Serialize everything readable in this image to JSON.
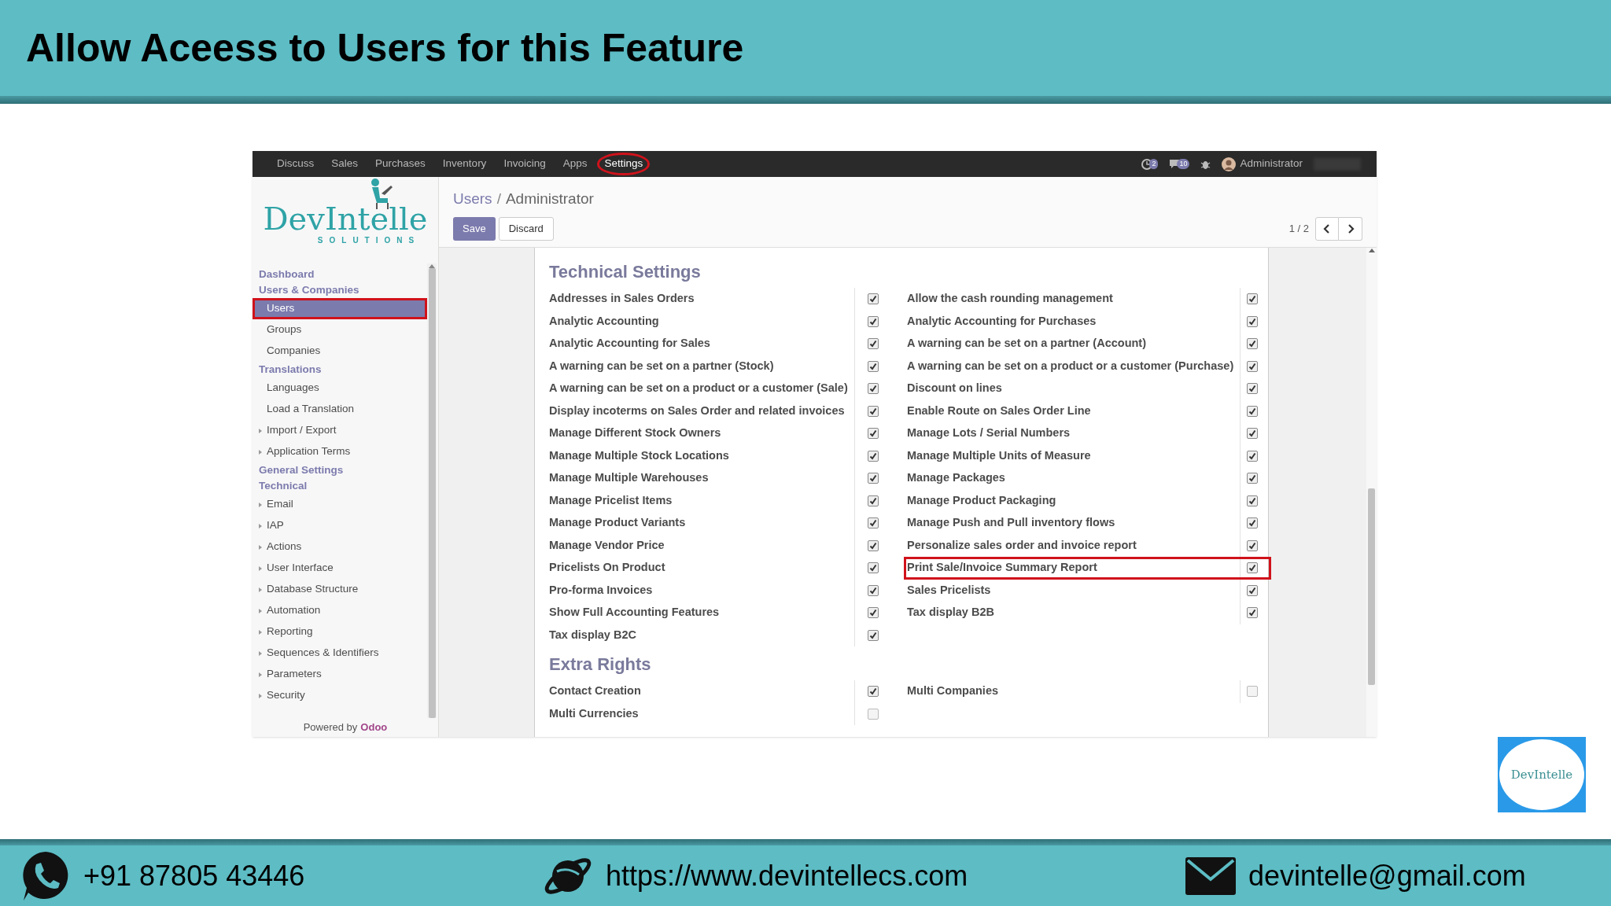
{
  "slide": {
    "title": "Allow Aceess to Users for this Feature"
  },
  "app": {
    "nav": [
      {
        "label": "Discuss",
        "selected": false,
        "circled": false
      },
      {
        "label": "Sales",
        "selected": false,
        "circled": false
      },
      {
        "label": "Purchases",
        "selected": false,
        "circled": false
      },
      {
        "label": "Inventory",
        "selected": false,
        "circled": false
      },
      {
        "label": "Invoicing",
        "selected": false,
        "circled": false
      },
      {
        "label": "Apps",
        "selected": false,
        "circled": false
      },
      {
        "label": "Settings",
        "selected": true,
        "circled": true
      }
    ],
    "systray": {
      "activity_badge": "2",
      "messages_badge": "10",
      "user": "Administrator"
    },
    "logo": {
      "wordmark": "DevIntelle",
      "tagline": "SOLUTIONS"
    },
    "sidebar": {
      "items": [
        {
          "kind": "header",
          "label": "Dashboard",
          "selected": false,
          "circled": false
        },
        {
          "kind": "header",
          "label": "Users & Companies",
          "selected": false,
          "circled": false
        },
        {
          "kind": "item",
          "label": "Users",
          "selected": true,
          "circled": true
        },
        {
          "kind": "item",
          "label": "Groups",
          "selected": false,
          "circled": false
        },
        {
          "kind": "item",
          "label": "Companies",
          "selected": false,
          "circled": false
        },
        {
          "kind": "header",
          "label": "Translations",
          "selected": false,
          "circled": false
        },
        {
          "kind": "item",
          "label": "Languages",
          "selected": false,
          "circled": false
        },
        {
          "kind": "item",
          "label": "Load a Translation",
          "selected": false,
          "circled": false
        },
        {
          "kind": "folder",
          "label": "Import / Export",
          "selected": false,
          "circled": false
        },
        {
          "kind": "folder",
          "label": "Application Terms",
          "selected": false,
          "circled": false
        },
        {
          "kind": "header",
          "label": "General Settings",
          "selected": false,
          "circled": false
        },
        {
          "kind": "header",
          "label": "Technical",
          "selected": false,
          "circled": false
        },
        {
          "kind": "folder",
          "label": "Email",
          "selected": false,
          "circled": false
        },
        {
          "kind": "folder",
          "label": "IAP",
          "selected": false,
          "circled": false
        },
        {
          "kind": "folder",
          "label": "Actions",
          "selected": false,
          "circled": false
        },
        {
          "kind": "folder",
          "label": "User Interface",
          "selected": false,
          "circled": false
        },
        {
          "kind": "folder",
          "label": "Database Structure",
          "selected": false,
          "circled": false
        },
        {
          "kind": "folder",
          "label": "Automation",
          "selected": false,
          "circled": false
        },
        {
          "kind": "folder",
          "label": "Reporting",
          "selected": false,
          "circled": false
        },
        {
          "kind": "folder",
          "label": "Sequences & Identifiers",
          "selected": false,
          "circled": false
        },
        {
          "kind": "folder",
          "label": "Parameters",
          "selected": false,
          "circled": false
        },
        {
          "kind": "folder",
          "label": "Security",
          "selected": false,
          "circled": false
        }
      ],
      "footer": {
        "text": "Powered by",
        "brand": "Odoo"
      }
    },
    "breadcrumb": {
      "separator": "/",
      "items": [
        {
          "label": "Users",
          "kind": "link"
        },
        {
          "label": "Administrator",
          "kind": "current"
        }
      ]
    },
    "buttons": [
      {
        "label": "Save",
        "kind": "primary"
      },
      {
        "label": "Discard",
        "kind": "secondary"
      }
    ],
    "pager": "1 / 2",
    "sections": [
      {
        "title": "Technical Settings",
        "left": [
          {
            "label": "Addresses in Sales Orders",
            "checked": true,
            "circled": false
          },
          {
            "label": "Analytic Accounting",
            "checked": true,
            "circled": false
          },
          {
            "label": "Analytic Accounting for Sales",
            "checked": true,
            "circled": false
          },
          {
            "label": "A warning can be set on a partner (Stock)",
            "checked": true,
            "circled": false
          },
          {
            "label": "A warning can be set on a product or a customer (Sale)",
            "checked": true,
            "circled": false
          },
          {
            "label": "Display incoterms on Sales Order and related invoices",
            "checked": true,
            "circled": false
          },
          {
            "label": "Manage Different Stock Owners",
            "checked": true,
            "circled": false
          },
          {
            "label": "Manage Multiple Stock Locations",
            "checked": true,
            "circled": false
          },
          {
            "label": "Manage Multiple Warehouses",
            "checked": true,
            "circled": false
          },
          {
            "label": "Manage Pricelist Items",
            "checked": true,
            "circled": false
          },
          {
            "label": "Manage Product Variants",
            "checked": true,
            "circled": false
          },
          {
            "label": "Manage Vendor Price",
            "checked": true,
            "circled": false
          },
          {
            "label": "Pricelists On Product",
            "checked": true,
            "circled": false
          },
          {
            "label": "Pro-forma Invoices",
            "checked": true,
            "circled": false
          },
          {
            "label": "Show Full Accounting Features",
            "checked": true,
            "circled": false
          },
          {
            "label": "Tax display B2C",
            "checked": true,
            "circled": false
          }
        ],
        "right": [
          {
            "label": "Allow the cash rounding management",
            "checked": true,
            "circled": false
          },
          {
            "label": "Analytic Accounting for Purchases",
            "checked": true,
            "circled": false
          },
          {
            "label": "A warning can be set on a partner (Account)",
            "checked": true,
            "circled": false
          },
          {
            "label": "A warning can be set on a product or a customer (Purchase)",
            "checked": true,
            "circled": false
          },
          {
            "label": "Discount on lines",
            "checked": true,
            "circled": false
          },
          {
            "label": "Enable Route on Sales Order Line",
            "checked": true,
            "circled": false
          },
          {
            "label": "Manage Lots / Serial Numbers",
            "checked": true,
            "circled": false
          },
          {
            "label": "Manage Multiple Units of Measure",
            "checked": true,
            "circled": false
          },
          {
            "label": "Manage Packages",
            "checked": true,
            "circled": false
          },
          {
            "label": "Manage Product Packaging",
            "checked": true,
            "circled": false
          },
          {
            "label": "Manage Push and Pull inventory flows",
            "checked": true,
            "circled": false
          },
          {
            "label": "Personalize sales order and invoice report",
            "checked": true,
            "circled": false
          },
          {
            "label": "Print Sale/Invoice Summary Report",
            "checked": true,
            "circled": true
          },
          {
            "label": "Sales Pricelists",
            "checked": true,
            "circled": false
          },
          {
            "label": "Tax display B2B",
            "checked": true,
            "circled": false
          }
        ]
      },
      {
        "title": "Extra Rights",
        "left": [
          {
            "label": "Contact Creation",
            "checked": true,
            "circled": false
          },
          {
            "label": "Multi Currencies",
            "checked": false,
            "circled": false
          }
        ],
        "right": [
          {
            "label": "Multi Companies",
            "checked": false,
            "circled": false
          }
        ]
      }
    ]
  },
  "corner_logo": {
    "wordmark": "DevIntelle"
  },
  "footer": [
    {
      "kind": "phone",
      "text": "+91 87805 43446"
    },
    {
      "kind": "web",
      "text": "https://www.devintellecs.com"
    },
    {
      "kind": "email",
      "text": "devintelle@gmail.com"
    }
  ]
}
